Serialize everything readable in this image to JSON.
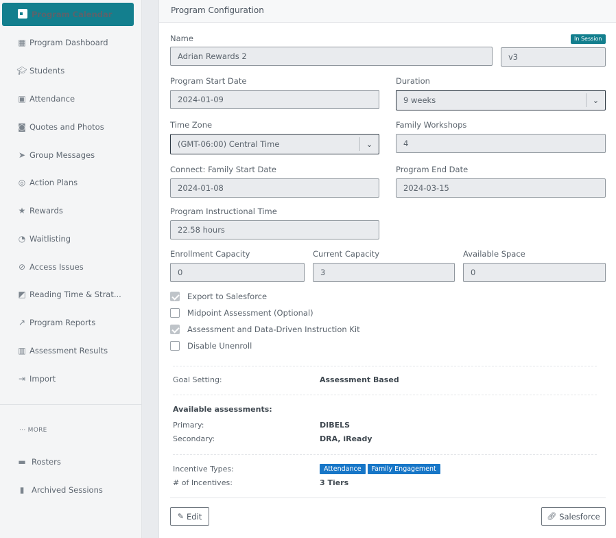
{
  "sidebar": {
    "active": {
      "label": "Program Calendar",
      "icon": "calendar-icon"
    },
    "items": [
      {
        "label": "Program Dashboard",
        "icon": "grid-icon"
      },
      {
        "label": "Students",
        "icon": "graduation-cap-icon"
      },
      {
        "label": "Attendance",
        "icon": "clipboard-user-icon"
      },
      {
        "label": "Quotes and Photos",
        "icon": "camera-icon"
      },
      {
        "label": "Group Messages",
        "icon": "paper-plane-icon"
      },
      {
        "label": "Action Plans",
        "icon": "target-icon"
      },
      {
        "label": "Rewards",
        "icon": "star-trophy-icon"
      },
      {
        "label": "Waitlisting",
        "icon": "user-clock-icon"
      },
      {
        "label": "Access Issues",
        "icon": "no-access-icon"
      },
      {
        "label": "Reading Time & Strat...",
        "icon": "chart-box-icon"
      },
      {
        "label": "Program Reports",
        "icon": "trend-line-icon"
      },
      {
        "label": "Assessment Results",
        "icon": "book-open-icon"
      },
      {
        "label": "Import",
        "icon": "import-icon"
      }
    ],
    "more_label": "··· MORE",
    "bottom_items": [
      {
        "label": "Rosters",
        "icon": "folder-user-icon"
      },
      {
        "label": "Archived Sessions",
        "icon": "lock-icon"
      }
    ]
  },
  "card": {
    "title": "Program Configuration",
    "status_badge": "In Session",
    "name": {
      "label": "Name",
      "value": "Adrian Rewards 2",
      "version": "v3"
    },
    "start_date": {
      "label": "Program Start Date",
      "value": "2024-01-09"
    },
    "duration": {
      "label": "Duration",
      "value": "9 weeks"
    },
    "time_zone": {
      "label": "Time Zone",
      "value": "(GMT-06:00) Central Time"
    },
    "family_workshops": {
      "label": "Family Workshops",
      "value": "4"
    },
    "connect_start": {
      "label": "Connect: Family Start Date",
      "value": "2024-01-08"
    },
    "end_date": {
      "label": "Program End Date",
      "value": "2024-03-15"
    },
    "instructional_time": {
      "label": "Program Instructional Time",
      "value": "22.58 hours"
    },
    "enrollment_capacity": {
      "label": "Enrollment Capacity",
      "value": "0"
    },
    "current_capacity": {
      "label": "Current Capacity",
      "value": "3"
    },
    "available_space": {
      "label": "Available Space",
      "value": "0"
    },
    "checkboxes": [
      {
        "label": "Export to Salesforce",
        "checked": true
      },
      {
        "label": "Midpoint Assessment (Optional)",
        "checked": false
      },
      {
        "label": "Assessment and Data-Driven Instruction Kit",
        "checked": true
      },
      {
        "label": "Disable Unenroll",
        "checked": false
      }
    ],
    "goal_setting": {
      "label": "Goal Setting:",
      "value": "Assessment Based"
    },
    "assessments": {
      "heading": "Available assessments:",
      "primary_label": "Primary:",
      "primary_value": "DIBELS",
      "secondary_label": "Secondary:",
      "secondary_value": "DRA, iReady"
    },
    "incentives": {
      "types_label": "Incentive Types:",
      "types": [
        "Attendance",
        "Family Engagement"
      ],
      "count_label": "# of Incentives:",
      "count_value": "3 Tiers"
    },
    "edit_button": "Edit",
    "salesforce_button": "Salesforce"
  },
  "colors": {
    "accent": "#137f8e",
    "tag": "#1776c7"
  }
}
